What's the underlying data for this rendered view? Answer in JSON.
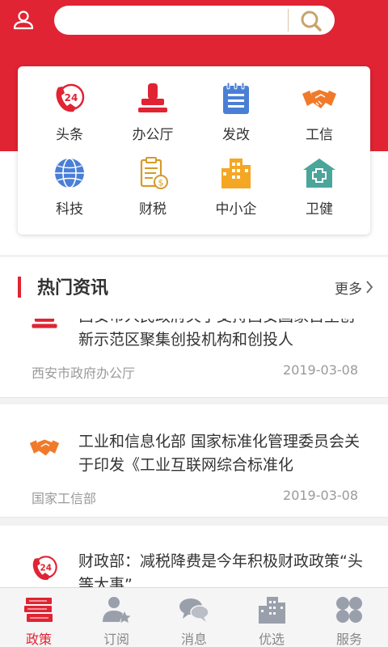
{
  "search": {
    "value": "",
    "placeholder": ""
  },
  "grid": {
    "items": [
      {
        "label": "头条",
        "icon": "headline-phone-24-icon"
      },
      {
        "label": "办公厅",
        "icon": "stamp-icon"
      },
      {
        "label": "发改",
        "icon": "notepad-icon"
      },
      {
        "label": "工信",
        "icon": "handshake-icon"
      },
      {
        "label": "科技",
        "icon": "globe-icon"
      },
      {
        "label": "财税",
        "icon": "tax-document-icon"
      },
      {
        "label": "中小企",
        "icon": "building-icon"
      },
      {
        "label": "卫健",
        "icon": "hospital-icon"
      }
    ]
  },
  "section": {
    "title": "热门资讯",
    "more_label": "更多"
  },
  "news": [
    {
      "title": "西安市人民政府关于支持西安国家自主创新示范区聚集创投机构和创投人",
      "source": "西安市政府办公厅",
      "date": "2019-03-08",
      "icon": "stamp-icon"
    },
    {
      "title": "工业和信息化部 国家标准化管理委员会关于印发《工业互联网综合标准化",
      "source": "国家工信部",
      "date": "2019-03-08",
      "icon": "handshake-icon"
    },
    {
      "title": "财政部：减税降费是今年积极财政政策“头等大事”",
      "source": "",
      "date": "",
      "icon": "headline-phone-24-icon"
    }
  ],
  "tabs": [
    {
      "label": "政策",
      "icon": "books-icon",
      "active": true
    },
    {
      "label": "订阅",
      "icon": "subscribe-user-star-icon",
      "active": false
    },
    {
      "label": "消息",
      "icon": "chat-bubbles-icon",
      "active": false
    },
    {
      "label": "优选",
      "icon": "buildings-icon",
      "active": false
    },
    {
      "label": "服务",
      "icon": "clover-grid-icon",
      "active": false
    }
  ],
  "colors": {
    "brand_red": "#e02433",
    "orange": "#f07a2a",
    "blue": "#4a7fd6",
    "teal": "#4aa59a",
    "gray_text": "#9a9a9a"
  }
}
